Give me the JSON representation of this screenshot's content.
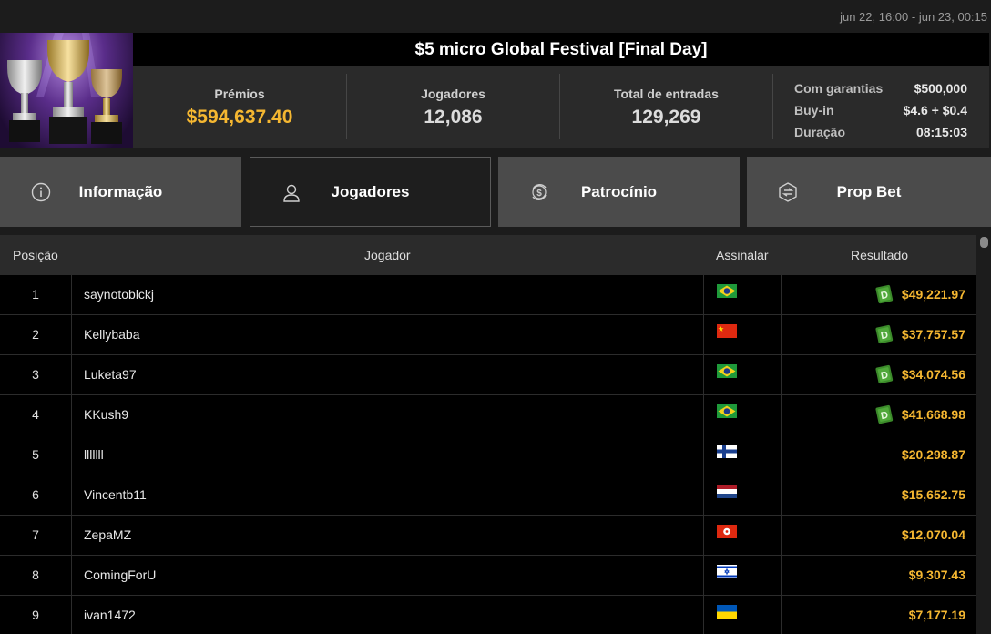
{
  "date_range": "jun 22, 16:00 - jun 23, 00:15",
  "tournament": {
    "title": "$5 micro Global Festival [Final Day]",
    "prizes_label": "Prémios",
    "prizes_value": "$594,637.40",
    "players_label": "Jogadores",
    "players_value": "12,086",
    "entries_label": "Total de entradas",
    "entries_value": "129,269",
    "guaranteed_label": "Com garantias",
    "guaranteed_value": "$500,000",
    "buyin_label": "Buy-in",
    "buyin_value": "$4.6 + $0.4",
    "duration_label": "Duração",
    "duration_value": "08:15:03"
  },
  "tabs": [
    {
      "label": "Informação",
      "icon": "info-icon"
    },
    {
      "label": "Jogadores",
      "icon": "user-icon",
      "active": true
    },
    {
      "label": "Patrocínio",
      "icon": "dollar-cycle-icon"
    },
    {
      "label": "Prop Bet",
      "icon": "prop-bet-icon"
    }
  ],
  "table": {
    "headers": {
      "position": "Posição",
      "player": "Jogador",
      "flag": "Assinalar",
      "result": "Resultado"
    },
    "rows": [
      {
        "pos": "1",
        "name": "saynotoblckj",
        "flag": "brazil",
        "result": "$49,221.97",
        "bounty": true
      },
      {
        "pos": "2",
        "name": "Kellybaba",
        "flag": "china",
        "result": "$37,757.57",
        "bounty": true
      },
      {
        "pos": "3",
        "name": "Luketa97",
        "flag": "brazil",
        "result": "$34,074.56",
        "bounty": true
      },
      {
        "pos": "4",
        "name": "KKush9",
        "flag": "brazil",
        "result": "$41,668.98",
        "bounty": true
      },
      {
        "pos": "5",
        "name": "lllllll",
        "flag": "finland",
        "result": "$20,298.87",
        "bounty": false
      },
      {
        "pos": "6",
        "name": "Vincentb11",
        "flag": "netherlands",
        "result": "$15,652.75",
        "bounty": false
      },
      {
        "pos": "7",
        "name": "ZepaMZ",
        "flag": "hong-kong",
        "result": "$12,070.04",
        "bounty": false
      },
      {
        "pos": "8",
        "name": "ComingForU",
        "flag": "israel",
        "result": "$9,307.43",
        "bounty": false
      },
      {
        "pos": "9",
        "name": "ivan1472",
        "flag": "ukraine",
        "result": "$7,177.19",
        "bounty": false
      }
    ]
  },
  "colors": {
    "gold": "#f5b731",
    "bounty_green": "#3b8a2a"
  }
}
